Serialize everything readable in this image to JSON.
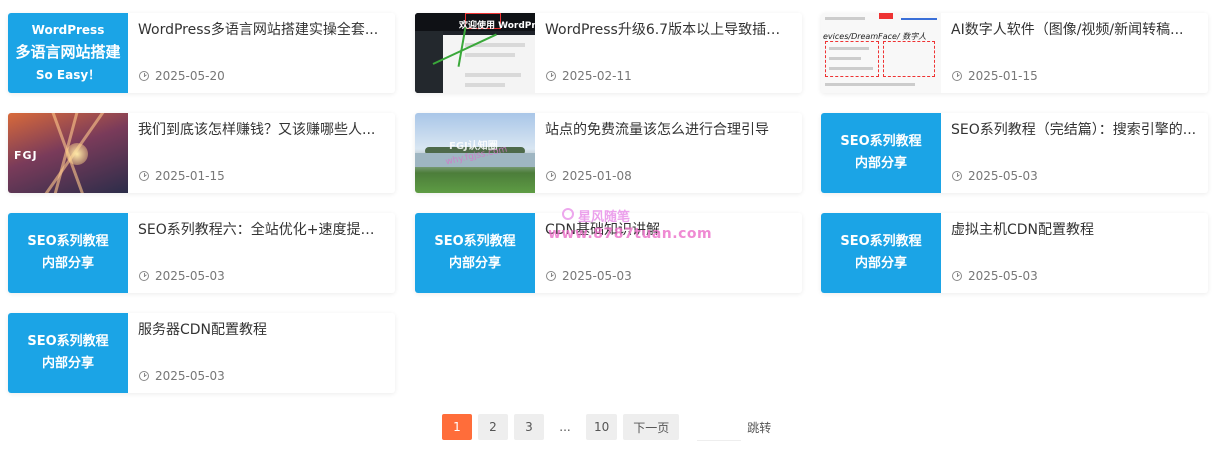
{
  "cards": [
    {
      "title": "WordPress多语言网站搭建实操全套...",
      "date": "2025-05-20",
      "thumb": {
        "line1": "WordPress",
        "line2": "多语言网站搭建",
        "line3": "So Easy！"
      }
    },
    {
      "title": "WordPress升级6.7版本以上导致插件...",
      "date": "2025-02-11",
      "thumb": {
        "header": "欢迎使用 WordPress"
      }
    },
    {
      "title": "AI数字人软件（图像/视频/新闻转稿...",
      "date": "2025-01-15",
      "thumb": {
        "text": "evices/DreamFace/ 数字人"
      }
    },
    {
      "title": "我们到底该怎样赚钱？又该赚哪些人...",
      "date": "2025-01-15",
      "thumb": {
        "logo": "FGJ"
      }
    },
    {
      "title": "站点的免费流量该怎么进行合理引导",
      "date": "2025-01-08",
      "thumb": {
        "wm1": "FGJ认知圈",
        "wm2": "why.fgjss.com"
      }
    },
    {
      "title": "SEO系列教程（完结篇）：搜索引擎的...",
      "date": "2025-05-03",
      "thumb": {
        "line1": "SEO系列教程",
        "line2": "内部分享"
      }
    },
    {
      "title": "SEO系列教程六：全站优化+速度提升...",
      "date": "2025-05-03",
      "thumb": {
        "line1": "SEO系列教程",
        "line2": "内部分享"
      }
    },
    {
      "title": "CDN基础知识讲解",
      "date": "2025-05-03",
      "thumb": {
        "line1": "SEO系列教程",
        "line2": "内部分享"
      }
    },
    {
      "title": "虚拟主机CDN配置教程",
      "date": "2025-05-03",
      "thumb": {
        "line1": "SEO系列教程",
        "line2": "内部分享"
      }
    },
    {
      "title": "服务器CDN配置教程",
      "date": "2025-05-03",
      "thumb": {
        "line1": "SEO系列教程",
        "line2": "内部分享"
      }
    }
  ],
  "watermark": {
    "line1": "星风随笔",
    "line2": "www.8787tuan.com"
  },
  "pagination": {
    "pages": [
      "1",
      "2",
      "3",
      "...",
      "10"
    ],
    "current": "1",
    "next_label": "下一页",
    "jump_label": "跳转",
    "jump_value": ""
  },
  "colors": {
    "accent": "#ff6d3a",
    "thumb_blue": "#1ba4e6"
  }
}
